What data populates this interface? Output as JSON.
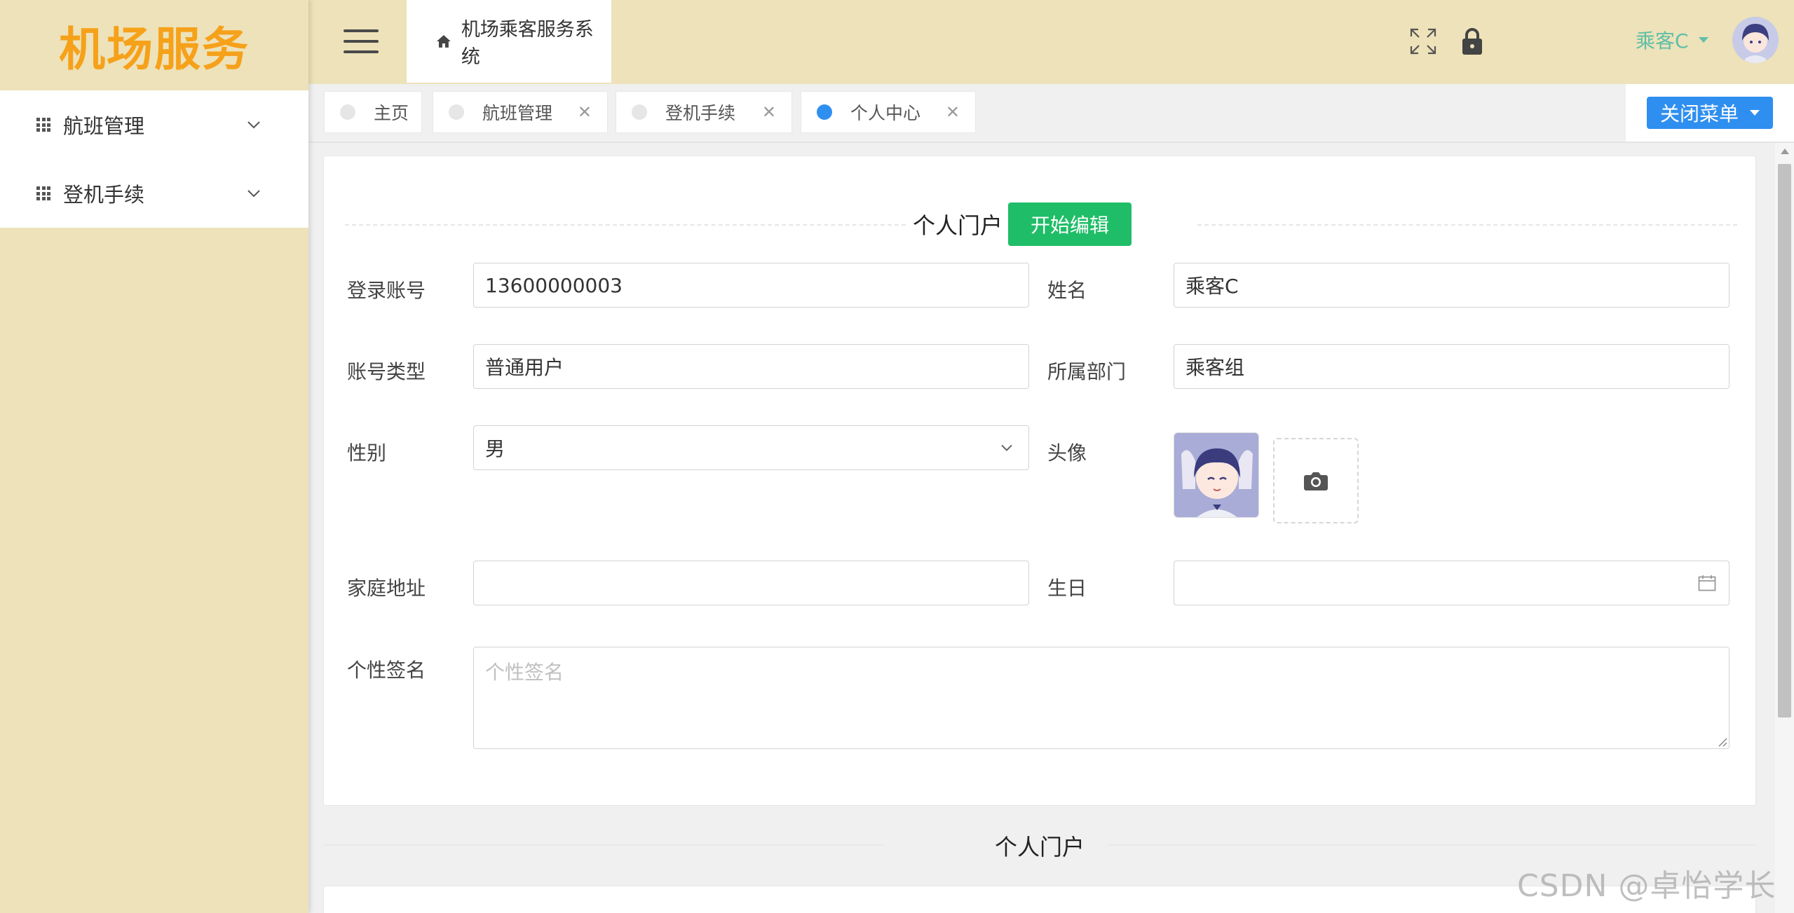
{
  "sidebar": {
    "logo": "机场服务",
    "items": [
      {
        "label": "航班管理",
        "icon": "grid-icon"
      },
      {
        "label": "登机手续",
        "icon": "grid-icon"
      }
    ]
  },
  "topbar": {
    "breadcrumb": "机场乘客服务系统",
    "username": "乘客C"
  },
  "tabs": [
    {
      "label": "主页",
      "active": false,
      "closable": false
    },
    {
      "label": "航班管理",
      "active": false,
      "closable": true
    },
    {
      "label": "登机手续",
      "active": false,
      "closable": true
    },
    {
      "label": "个人中心",
      "active": true,
      "closable": true
    }
  ],
  "close_menu_label": "关闭菜单",
  "profile": {
    "section_title": "个人门户",
    "edit_label": "开始编辑",
    "fields": {
      "account": {
        "label": "登录账号",
        "value": "13600000003"
      },
      "name": {
        "label": "姓名",
        "value": "乘客C"
      },
      "account_type": {
        "label": "账号类型",
        "value": "普通用户"
      },
      "department": {
        "label": "所属部门",
        "value": "乘客组"
      },
      "gender": {
        "label": "性别",
        "value": "男"
      },
      "avatar": {
        "label": "头像"
      },
      "address": {
        "label": "家庭地址",
        "value": ""
      },
      "birthday": {
        "label": "生日",
        "value": ""
      },
      "signature": {
        "label": "个性签名",
        "placeholder": "个性签名"
      }
    }
  },
  "section2_title": "个人门户",
  "watermark": "CSDN @卓怡学长",
  "colors": {
    "sidebar_bg": "#ede2b9",
    "logo": "#f6a11a",
    "accent_blue": "#2f8ff0",
    "edit_green": "#1fbd67",
    "username": "#5fbfa7"
  }
}
